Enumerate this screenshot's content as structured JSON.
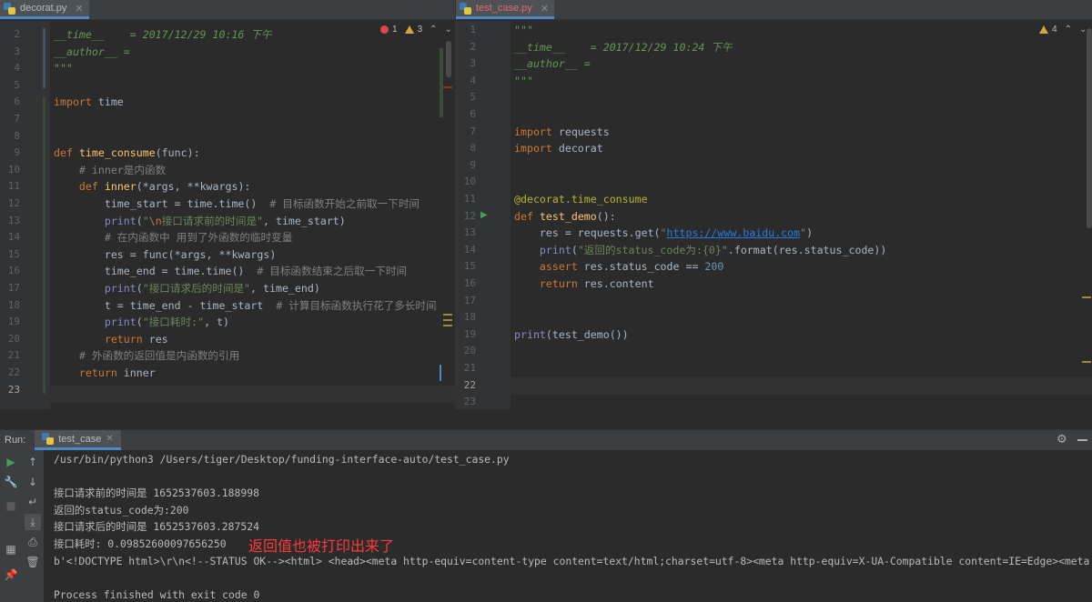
{
  "left_editor": {
    "tab": {
      "label": "decorat.py"
    },
    "inspections": {
      "errors": "1",
      "warnings": "3"
    },
    "lines": [
      {
        "n": "2",
        "html": "<span class=\"doc\">__time__    = 2017/12/29 10:16 下午</span>"
      },
      {
        "n": "3",
        "html": "<span class=\"doc\">__author__ =</span>"
      },
      {
        "n": "4",
        "html": "<span class=\"doc\">\"\"\"</span>"
      },
      {
        "n": "5",
        "html": ""
      },
      {
        "n": "6",
        "html": "<span class=\"kw\">import</span> time"
      },
      {
        "n": "7",
        "html": ""
      },
      {
        "n": "8",
        "html": ""
      },
      {
        "n": "9",
        "html": "<span class=\"kw\">def</span> <span class=\"fn\">time_consume</span>(func):"
      },
      {
        "n": "10",
        "html": "    <span class=\"cm\"># inner是内函数</span>"
      },
      {
        "n": "11",
        "html": "    <span class=\"kw\">def</span> <span class=\"fn\">inner</span>(*args, **kwargs):"
      },
      {
        "n": "12",
        "html": "        time_start = time.time()  <span class=\"cm\"># 目标函数开始之前取一下时间</span>"
      },
      {
        "n": "13",
        "html": "        <span class=\"bi\">print</span>(<span class=\"str\">\"<span class=\"esc\">\\n</span>接口请求前的时间是\"</span>, time_start)"
      },
      {
        "n": "14",
        "html": "        <span class=\"cm\"># 在内函数中 用到了外函数的临时变量</span>"
      },
      {
        "n": "15",
        "html": "        res = func(*args, **kwargs)"
      },
      {
        "n": "16",
        "html": "        time_end = time.time()  <span class=\"cm\"># 目标函数结束之后取一下时间</span>"
      },
      {
        "n": "17",
        "html": "        <span class=\"bi\">print</span>(<span class=\"str\">\"接口请求后的时间是\"</span>, time_end)"
      },
      {
        "n": "18",
        "html": "        t = time_end - time_start  <span class=\"cm\"># 计算目标函数执行花了多长时间</span>"
      },
      {
        "n": "19",
        "html": "        <span class=\"bi\">print</span>(<span class=\"str\">\"接口耗时:\"</span>, t)"
      },
      {
        "n": "20",
        "html": "        <span class=\"kw\">return</span> res"
      },
      {
        "n": "21",
        "html": "    <span class=\"cm\"># 外函数的返回值是内函数的引用</span>"
      },
      {
        "n": "22",
        "html": "    <span class=\"kw\">return</span> inner"
      },
      {
        "n": "23",
        "html": ""
      }
    ]
  },
  "right_editor": {
    "tab": {
      "label": "test_case.py"
    },
    "inspections": {
      "warnings": "4"
    },
    "lines": [
      {
        "n": "1",
        "html": "<span class=\"doc\">\"\"\"</span>"
      },
      {
        "n": "2",
        "html": "<span class=\"doc\">__time__    = 2017/12/29 10:24 下午</span>"
      },
      {
        "n": "3",
        "html": "<span class=\"doc\">__author__ =</span>"
      },
      {
        "n": "4",
        "html": "<span class=\"doc\">\"\"\"</span>"
      },
      {
        "n": "5",
        "html": ""
      },
      {
        "n": "6",
        "html": ""
      },
      {
        "n": "7",
        "html": "<span class=\"kw\">import</span> requests"
      },
      {
        "n": "8",
        "html": "<span class=\"kw\">import</span> decorat"
      },
      {
        "n": "9",
        "html": ""
      },
      {
        "n": "10",
        "html": ""
      },
      {
        "n": "11",
        "html": "<span class=\"dec\">@decorat.time_consume</span>"
      },
      {
        "n": "12",
        "html": "<span class=\"kw\">def</span> <span class=\"fn\">test_demo</span>():"
      },
      {
        "n": "13",
        "html": "    res = requests.get(<span class=\"str\">\"<span class=\"url\">https://www.baidu.com</span>\"</span>)"
      },
      {
        "n": "14",
        "html": "    <span class=\"bi\">print</span>(<span class=\"str\">\"返回的status_code为:{0}\"</span>.format(res.status_code))"
      },
      {
        "n": "15",
        "html": "    <span class=\"kw\">assert</span> res.status_code == <span class=\"num\">200</span>"
      },
      {
        "n": "16",
        "html": "    <span class=\"kw\">return</span> res.content"
      },
      {
        "n": "17",
        "html": ""
      },
      {
        "n": "18",
        "html": ""
      },
      {
        "n": "19",
        "html": "<span class=\"bi\">print</span>(test_demo())"
      },
      {
        "n": "20",
        "html": ""
      },
      {
        "n": "21",
        "html": ""
      },
      {
        "n": "22",
        "html": ""
      },
      {
        "n": "23",
        "html": ""
      }
    ]
  },
  "run": {
    "label": "Run:",
    "tab_label": "test_case",
    "output": [
      "/usr/bin/python3 /Users/tiger/Desktop/funding-interface-auto/test_case.py",
      "",
      "接口请求前的时间是 1652537603.188998",
      "返回的status_code为:200",
      "接口请求后的时间是 1652537603.287524",
      "接口耗时: 0.09852600097656250",
      "b'<!DOCTYPE html>\\r\\n<!--STATUS OK--><html> <head><meta http-equiv=content-type content=text/html;charset=utf-8><meta http-equiv=X-UA-Compatible content=IE=Edge><meta content",
      "",
      "Process finished with exit code 0"
    ],
    "annotation": "返回值也被打印出来了"
  }
}
